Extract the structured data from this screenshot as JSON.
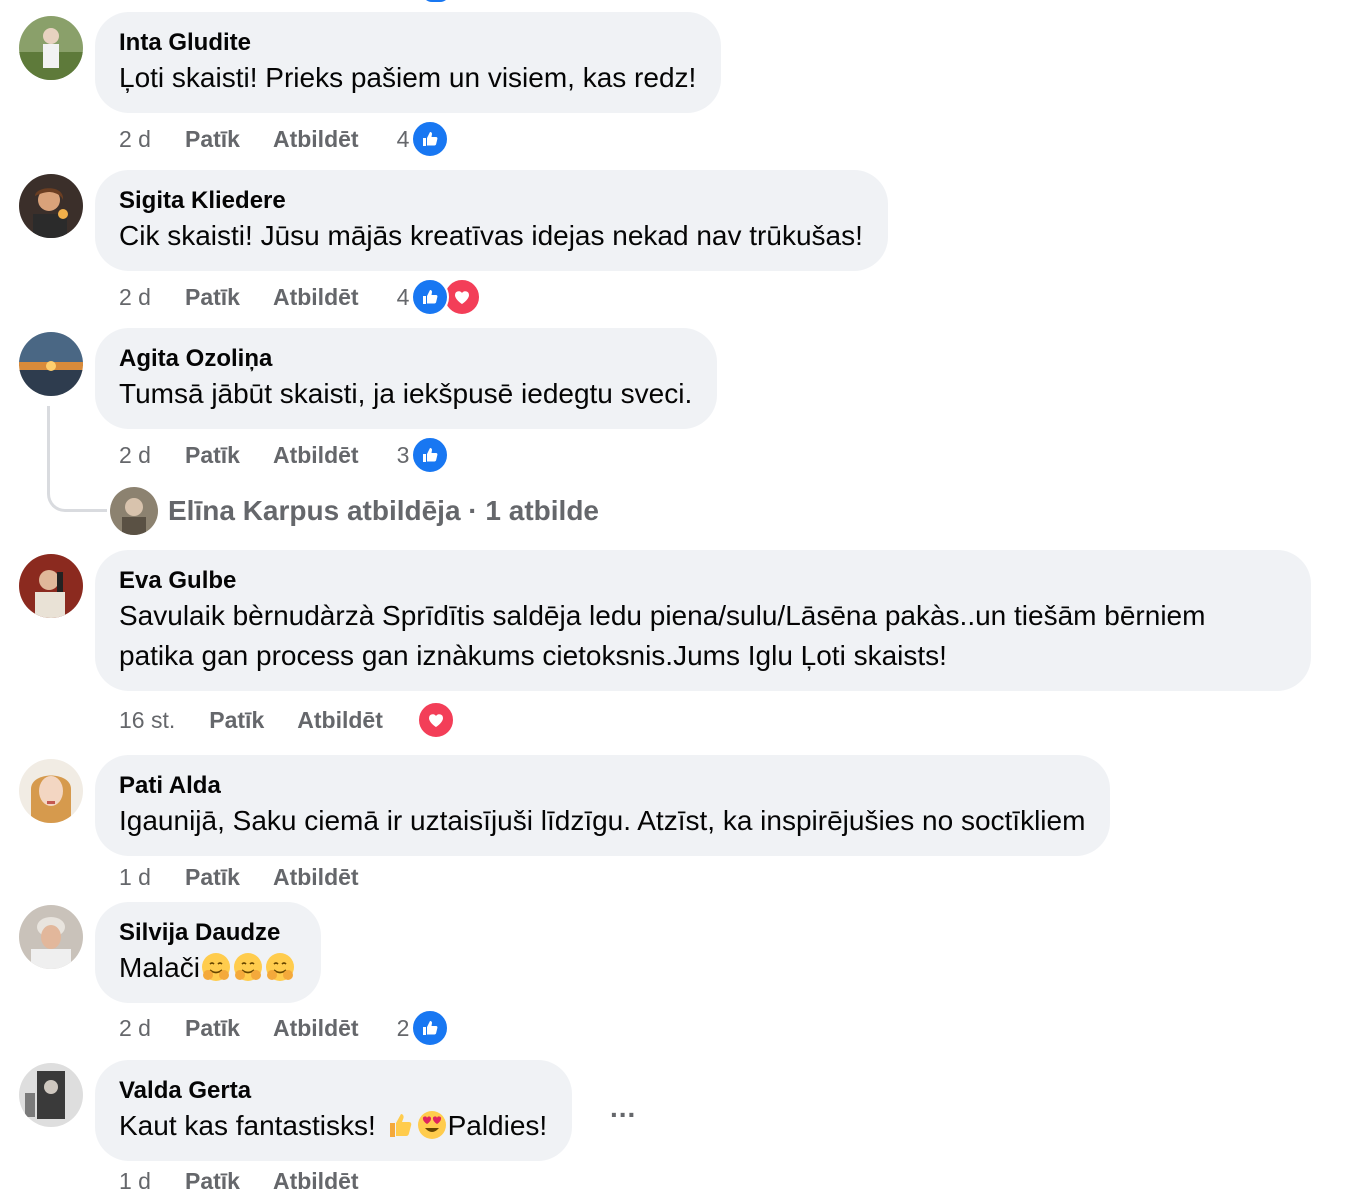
{
  "comments": [
    {
      "author": "Inta Gludite",
      "text": "Ļoti skaisti! Prieks pašiem un visiem, kas redz!",
      "time": "2 d",
      "like": "Patīk",
      "reply": "Atbildēt",
      "reactions": "4"
    },
    {
      "author": "Sigita Kliedere",
      "text": "Cik skaisti! Jūsu mājās kreatīvas idejas nekad nav trūkušas!",
      "time": "2 d",
      "like": "Patīk",
      "reply": "Atbildēt",
      "reactions": "4"
    },
    {
      "author": "Agita Ozoliņa",
      "text": "Tumsā jābūt skaisti, ja iekšpusē iedegtu sveci.",
      "time": "2 d",
      "like": "Patīk",
      "reply": "Atbildēt",
      "reactions": "3"
    },
    {
      "author": "Eva Gulbe",
      "text": "Savulaik bèrnudàrzà Sprīdītis saldēja ledu piena/sulu/Lāsēna pakàs..un tiešām bērniem patika gan process gan iznàkums cietoksnis.Jums Iglu Ļoti skaists!",
      "time": "16 st.",
      "like": "Patīk",
      "reply": "Atbildēt"
    },
    {
      "author": "Pati Alda",
      "text": "Igaunijā, Saku ciemā ir uztaisījuši līdzīgu. Atzīst, ka inspirējušies no soctīkliem",
      "time": "1 d",
      "like": "Patīk",
      "reply": "Atbildēt"
    },
    {
      "author": "Silvija Daudze",
      "text": "Malači",
      "time": "2 d",
      "like": "Patīk",
      "reply": "Atbildēt",
      "reactions": "2"
    },
    {
      "author": "Valda Gerta",
      "text_a": "Kaut kas fantastisks! ",
      "text_b": "Paldies!",
      "time": "1 d",
      "like": "Patīk",
      "reply": "Atbildēt"
    }
  ],
  "thread_reply": "Elīna Karpus atbildēja · 1 atbilde",
  "more_label": "...",
  "colors": {
    "like_blue": "#1877f2",
    "love_red": "#f33e58",
    "bubble": "#f0f2f5",
    "meta_gray": "#65676b"
  }
}
